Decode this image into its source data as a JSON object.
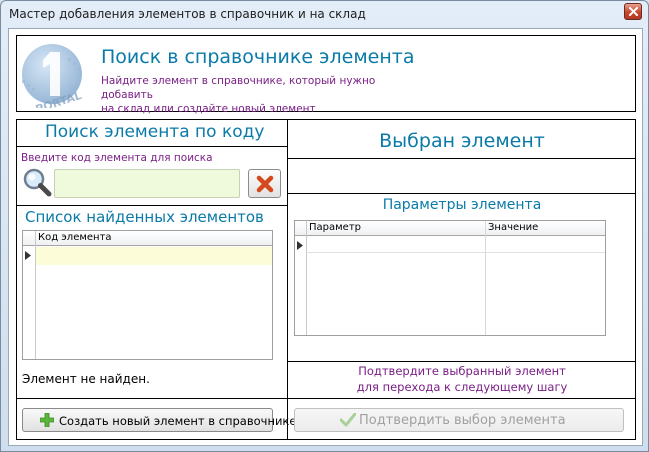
{
  "window": {
    "title": "Мастер добавления элементов в справочник и на склад"
  },
  "header": {
    "title": "Поиск в справочнике элемента",
    "subtitle_line1": "Найдите элемент в справочнике, который нужно добавить",
    "subtitle_line2": "на склад или создайте новый элемент"
  },
  "left": {
    "search_title": "Поиск элемента по коду",
    "search_hint": "Введите код элемента для поиска",
    "code_input_value": "",
    "list_title": "Список найденных элементов",
    "grid": {
      "columns": [
        "Код элемента"
      ],
      "rows": []
    },
    "status": "Элемент не найден.",
    "create_button": "Создать новый элемент в справочнике"
  },
  "right": {
    "selected_title": "Выбран элемент",
    "selected_value": "",
    "params_title": "Параметры элемента",
    "grid": {
      "columns": [
        "Параметр",
        "Значение"
      ],
      "rows": []
    },
    "confirm_hint_line1": "Подтвердите выбранный элемент",
    "confirm_hint_line2": "для перехода к следующему шагу",
    "confirm_button": "Подтвердить выбор элемента"
  },
  "colors": {
    "accent_title": "#0a7aa8",
    "hint_text": "#7a1f86",
    "input_bg": "#eff9dc",
    "selected_row_bg": "#fcfcd9"
  },
  "icons": {
    "logo": "portal-logo-icon",
    "search": "magnifier-icon",
    "clear": "red-x-icon",
    "create": "green-plus-icon",
    "confirm": "check-icon"
  }
}
